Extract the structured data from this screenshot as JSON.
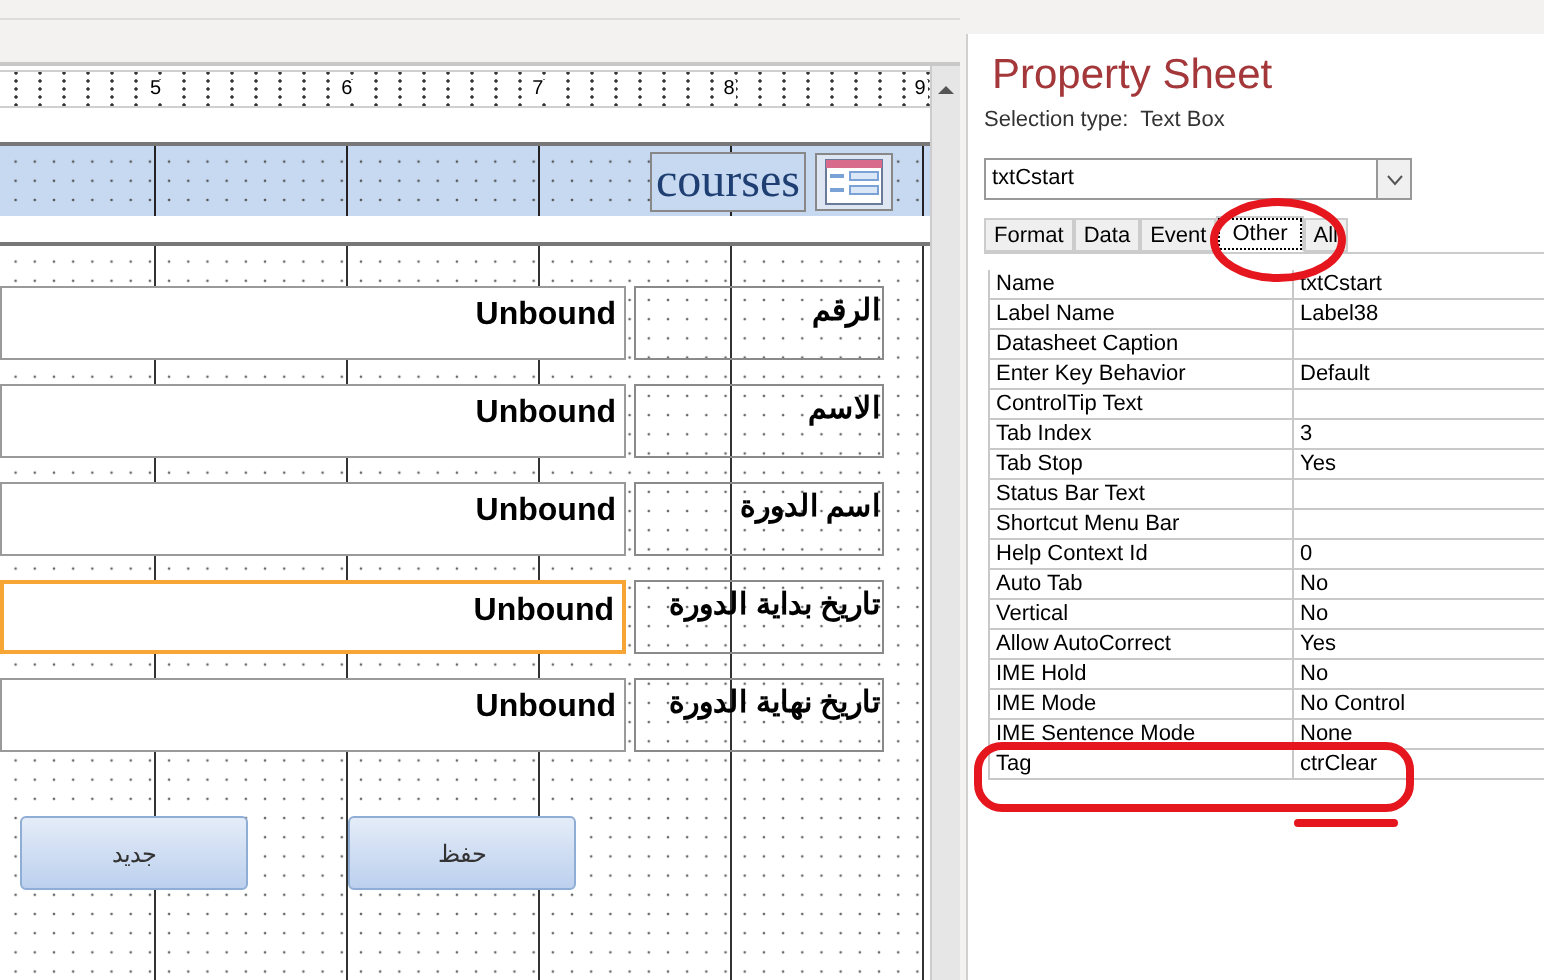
{
  "ruler": {
    "marks": [
      "5",
      "6",
      "7",
      "8",
      "9"
    ]
  },
  "form_header": {
    "title": "courses"
  },
  "fields": [
    {
      "label": "الرقم",
      "value": "Unbound",
      "selected": false
    },
    {
      "label": "الاسم",
      "value": "Unbound",
      "selected": false
    },
    {
      "label": "اسم الدورة",
      "value": "Unbound",
      "selected": false
    },
    {
      "label": "تاريخ بداية الدورة",
      "value": "Unbound",
      "selected": true
    },
    {
      "label": "تاريخ نهاية الدورة",
      "value": "Unbound",
      "selected": false
    }
  ],
  "buttons": [
    "حفظ",
    "جديد"
  ],
  "property_sheet": {
    "title": "Property Sheet",
    "selection_type_label": "Selection type:",
    "selection_type": "Text Box",
    "object": "txtCstart",
    "tabs": [
      {
        "label": "Format",
        "selected": false
      },
      {
        "label": "Data",
        "selected": false
      },
      {
        "label": "Event",
        "selected": false
      },
      {
        "label": "Other",
        "selected": true
      },
      {
        "label": "All",
        "selected": false
      }
    ],
    "properties": [
      {
        "name": "Name",
        "value": "txtCstart"
      },
      {
        "name": "Label Name",
        "value": "Label38"
      },
      {
        "name": "Datasheet Caption"
      },
      {
        "name": "Enter Key Behavior",
        "value": "Default"
      },
      {
        "name": "ControlTip Text"
      },
      {
        "name": "Tab Index",
        "value": "3"
      },
      {
        "name": "Tab Stop",
        "value": "Yes"
      },
      {
        "name": "Status Bar Text"
      },
      {
        "name": "Shortcut Menu Bar"
      },
      {
        "name": "Help Context Id",
        "value": "0"
      },
      {
        "name": "Auto Tab",
        "value": "No"
      },
      {
        "name": "Vertical",
        "value": "No"
      },
      {
        "name": "Allow AutoCorrect",
        "value": "Yes"
      },
      {
        "name": "IME Hold",
        "value": "No"
      },
      {
        "name": "IME Mode",
        "value": "No Control"
      },
      {
        "name": "IME Sentence Mode",
        "value": "None"
      },
      {
        "name": "Tag",
        "value": "ctrClear"
      }
    ]
  }
}
